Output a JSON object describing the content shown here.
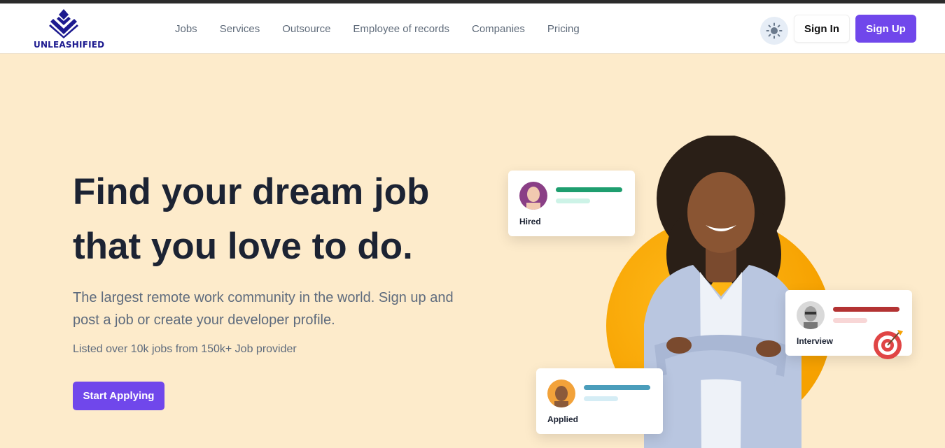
{
  "brand": {
    "name": "UNLEASHIFIED",
    "color": "#1d1a8f"
  },
  "nav": {
    "links": [
      "Jobs",
      "Services",
      "Outsource",
      "Employee of records",
      "Companies",
      "Pricing"
    ],
    "theme_icon": "sun-icon",
    "sign_in": "Sign In",
    "sign_up": "Sign Up"
  },
  "hero": {
    "title_line1": "Find your dream job",
    "title_line2": "that you love to do.",
    "subtitle": "The largest remote work community in the world. Sign up and post a job or create your developer profile.",
    "stat": "Listed over 10k jobs from 150k+ Job provider",
    "cta": "Start Applying"
  },
  "cards": {
    "hired": {
      "label": "Hired",
      "accent": "#1e9e6f",
      "accent_light": "#cdf3e7"
    },
    "interview": {
      "label": "Interview",
      "accent": "#b33333",
      "accent_light": "#f8d6d6"
    },
    "applied": {
      "label": "Applied",
      "accent": "#4a9dbb",
      "accent_light": "#d5edf5"
    }
  },
  "colors": {
    "primary": "#7047eb",
    "background": "#fdebcb",
    "circle": "#f6a100"
  }
}
